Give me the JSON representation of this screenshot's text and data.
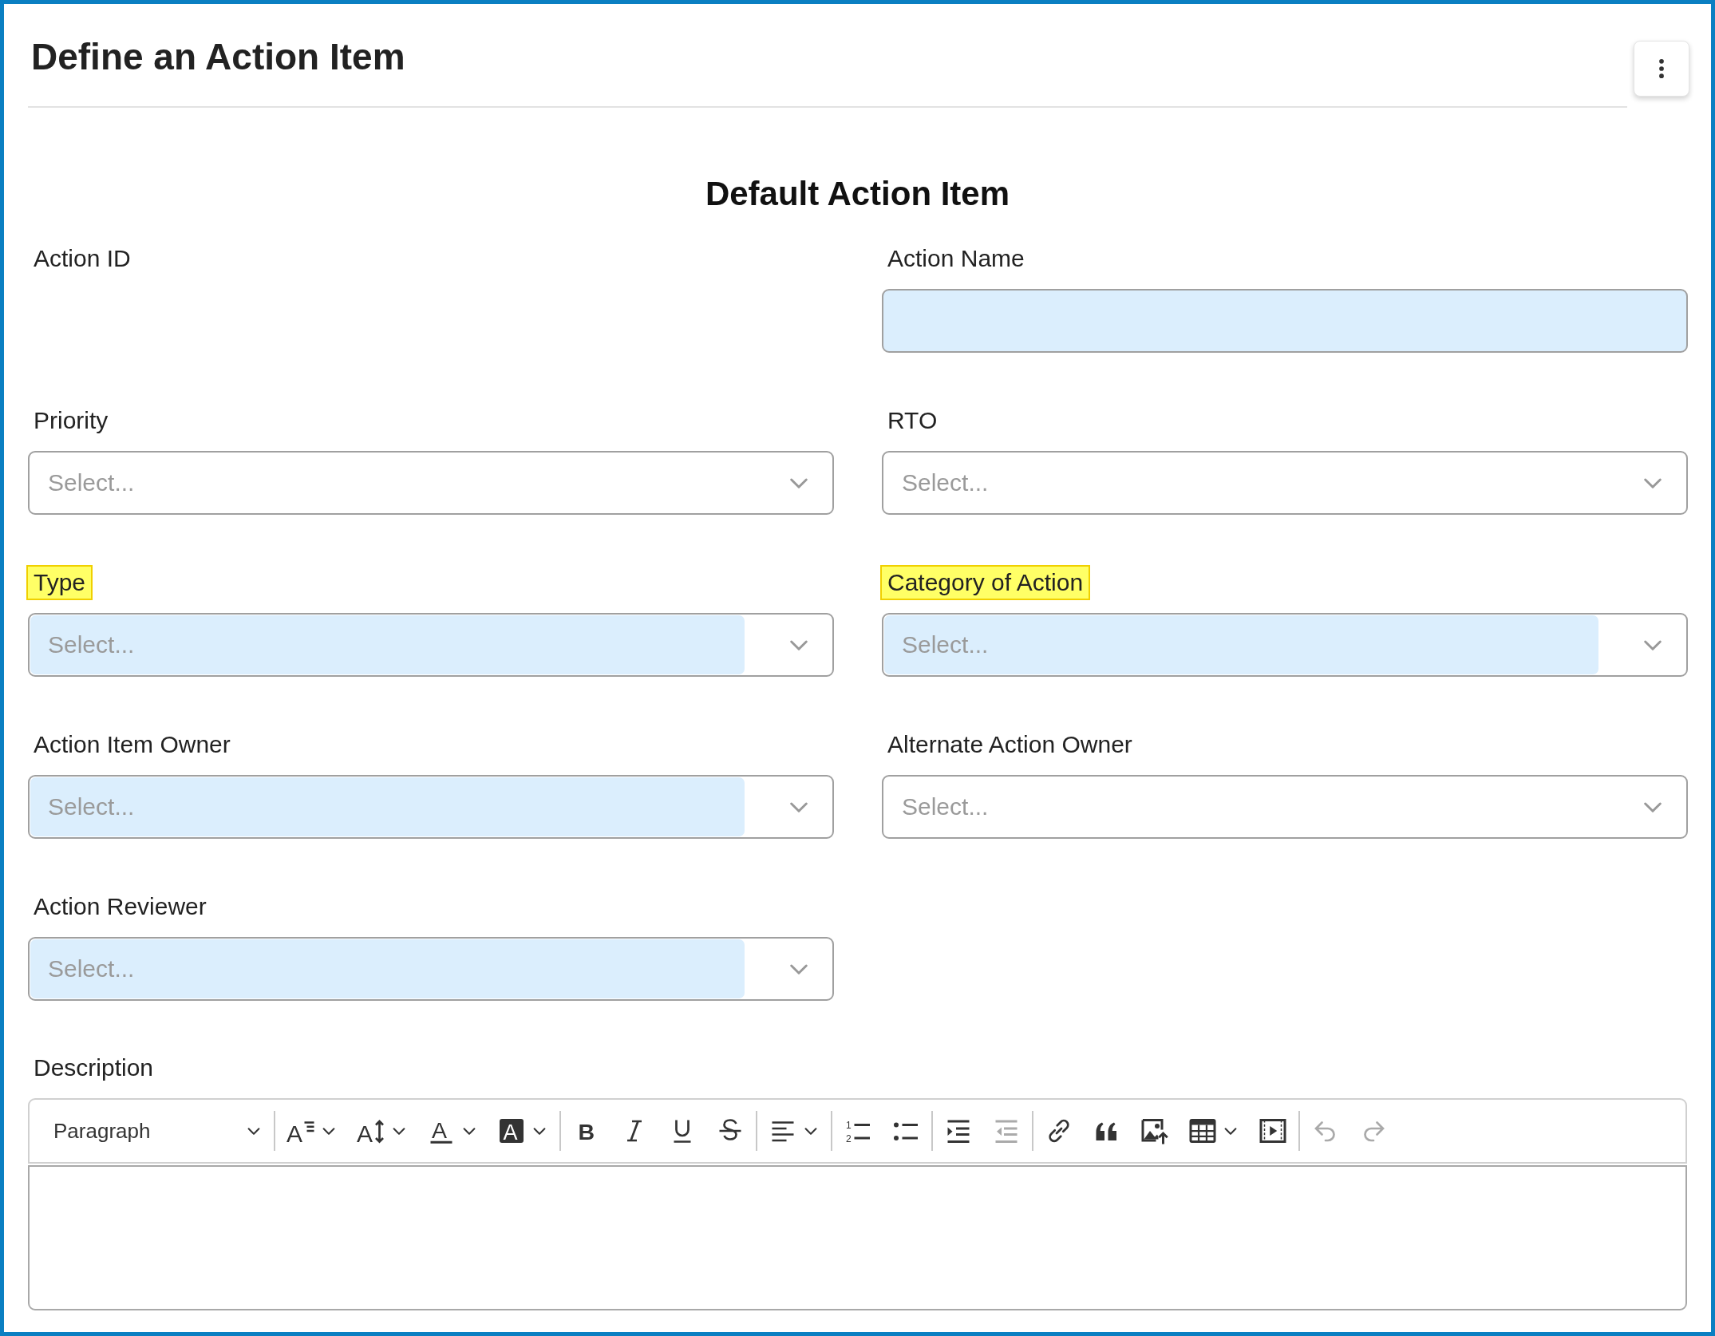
{
  "page": {
    "title": "Define an Action Item"
  },
  "form": {
    "title": "Default Action Item",
    "fields": [
      {
        "label": "Action ID",
        "highlighted": false,
        "kind": "readonly"
      },
      {
        "label": "Action Name",
        "highlighted": false,
        "kind": "text",
        "required": true
      },
      {
        "label": "Priority",
        "highlighted": false,
        "kind": "select",
        "placeholder": "Select...",
        "required": false
      },
      {
        "label": "RTO",
        "highlighted": false,
        "kind": "select",
        "placeholder": "Select...",
        "required": false
      },
      {
        "label": "Type",
        "highlighted": true,
        "kind": "select",
        "placeholder": "Select...",
        "required": true
      },
      {
        "label": "Category of Action",
        "highlighted": true,
        "kind": "select",
        "placeholder": "Select...",
        "required": true
      },
      {
        "label": "Action Item Owner",
        "highlighted": false,
        "kind": "select",
        "placeholder": "Select...",
        "required": true
      },
      {
        "label": "Alternate Action Owner",
        "highlighted": false,
        "kind": "select",
        "placeholder": "Select...",
        "required": false
      },
      {
        "label": "Action Reviewer",
        "highlighted": false,
        "kind": "select",
        "placeholder": "Select...",
        "required": true
      }
    ],
    "description": {
      "label": "Description",
      "toolbar": [
        [
          {
            "kind": "paragraph",
            "text": "Paragraph",
            "dropdown": true,
            "disabled": false
          }
        ],
        [
          {
            "kind": "font-size",
            "glyphs": [
              "A"
            ],
            "dropdown": true,
            "disabled": false
          },
          {
            "kind": "line-height",
            "glyphs": [
              "A"
            ],
            "dropdown": true,
            "disabled": false
          },
          {
            "kind": "font-color",
            "glyphs": [
              "A"
            ],
            "dropdown": true,
            "disabled": false
          },
          {
            "kind": "highlight",
            "glyphs": [
              "A"
            ],
            "dropdown": true,
            "disabled": false
          }
        ],
        [
          {
            "kind": "bold",
            "glyphs": [
              "B"
            ],
            "dropdown": false,
            "disabled": false
          },
          {
            "kind": "italic",
            "dropdown": false,
            "disabled": false
          },
          {
            "kind": "underline",
            "dropdown": false,
            "disabled": false
          },
          {
            "kind": "strikethrough",
            "dropdown": false,
            "disabled": false
          }
        ],
        [
          {
            "kind": "align",
            "dropdown": true,
            "disabled": false
          }
        ],
        [
          {
            "kind": "numbered-list",
            "glyphs": [
              "1",
              "2"
            ],
            "dropdown": false,
            "disabled": false
          },
          {
            "kind": "bulleted-list",
            "dropdown": false,
            "disabled": false
          }
        ],
        [
          {
            "kind": "indent",
            "dropdown": false,
            "disabled": false
          },
          {
            "kind": "outdent",
            "dropdown": false,
            "disabled": true
          }
        ],
        [
          {
            "kind": "link",
            "dropdown": false,
            "disabled": false
          },
          {
            "kind": "quote",
            "dropdown": false,
            "disabled": false
          },
          {
            "kind": "image",
            "dropdown": false,
            "disabled": false
          },
          {
            "kind": "table",
            "dropdown": true,
            "disabled": false
          },
          {
            "kind": "media",
            "dropdown": false,
            "disabled": false
          }
        ],
        [
          {
            "kind": "undo",
            "dropdown": false,
            "disabled": true
          },
          {
            "kind": "redo",
            "dropdown": false,
            "disabled": true
          }
        ]
      ]
    }
  }
}
